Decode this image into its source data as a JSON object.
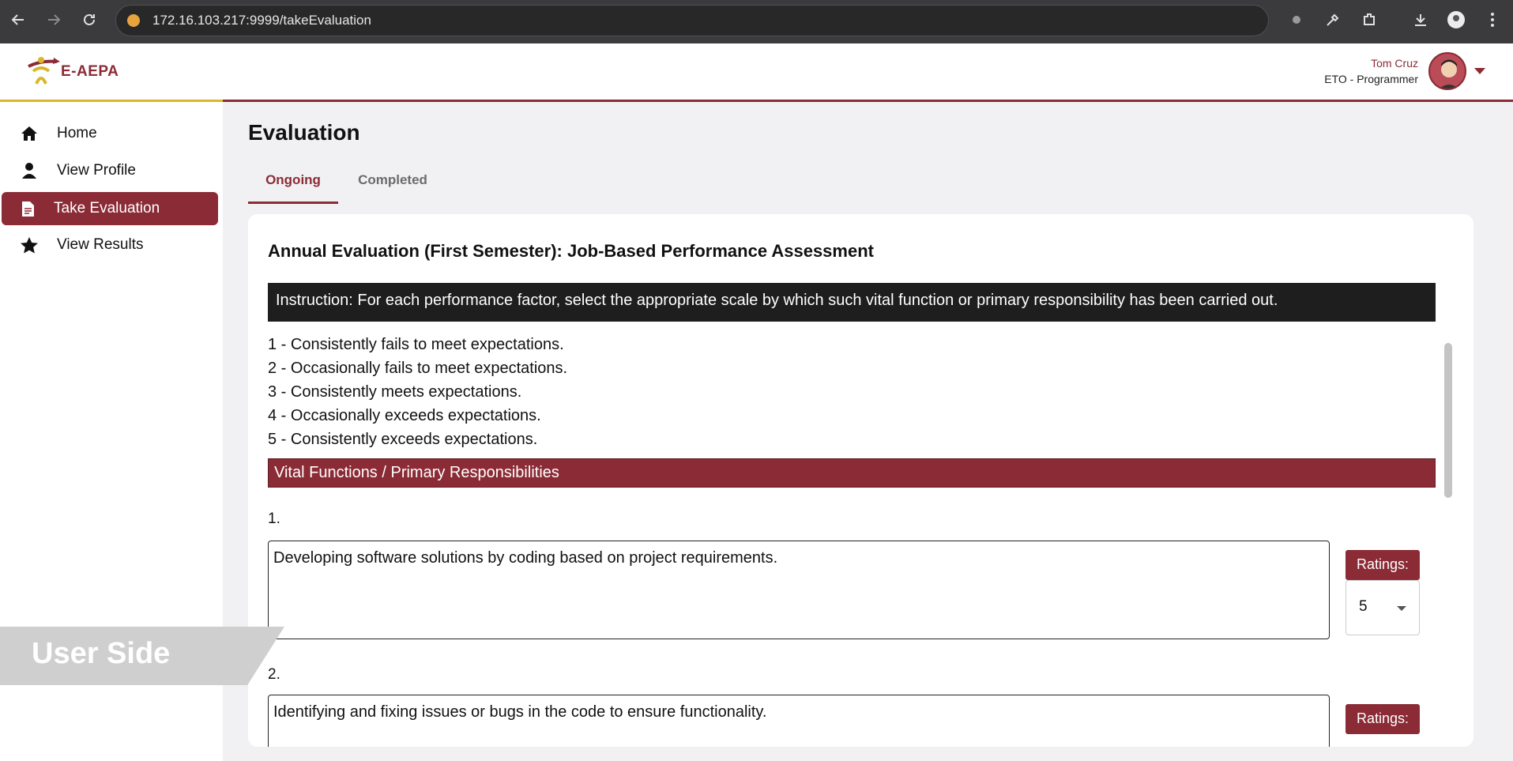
{
  "browser": {
    "url": "172.16.103.217:9999/takeEvaluation"
  },
  "header": {
    "logo_text": "E-AEPA",
    "user_name": "Tom Cruz",
    "user_role": "ETO - Programmer"
  },
  "sidebar": {
    "items": [
      {
        "label": "Home",
        "icon": "home-icon"
      },
      {
        "label": "View Profile",
        "icon": "user-icon"
      },
      {
        "label": "Take Evaluation",
        "icon": "document-icon",
        "active": true
      },
      {
        "label": "View Results",
        "icon": "star-icon"
      }
    ]
  },
  "watermark": "User Side",
  "main": {
    "title": "Evaluation",
    "tabs": [
      {
        "label": "Ongoing",
        "active": true
      },
      {
        "label": "Completed",
        "active": false
      }
    ],
    "card": {
      "title": "Annual Evaluation (First Semester): Job-Based Performance Assessment",
      "instruction": "Instruction: For each performance factor, select the appropriate scale by which such vital function or primary responsibility has been carried out.",
      "scale": [
        "1 - Consistently fails to meet expectations.",
        "2 - Occasionally fails to meet expectations.",
        "3 - Consistently meets expectations.",
        "4 - Occasionally exceeds expectations.",
        "5 - Consistently exceeds expectations."
      ],
      "section_title": "Vital Functions / Primary Responsibilities",
      "items": [
        {
          "number": "1.",
          "text": "Developing software solutions by coding based on project requirements.",
          "ratings_label": "Ratings:",
          "rating": "5"
        },
        {
          "number": "2.",
          "text": "Identifying and fixing issues or bugs in the code to ensure functionality.",
          "ratings_label": "Ratings:",
          "rating": ""
        }
      ]
    }
  },
  "colors": {
    "brand": "#8b2b35",
    "accent_gold": "#d9b72b"
  }
}
